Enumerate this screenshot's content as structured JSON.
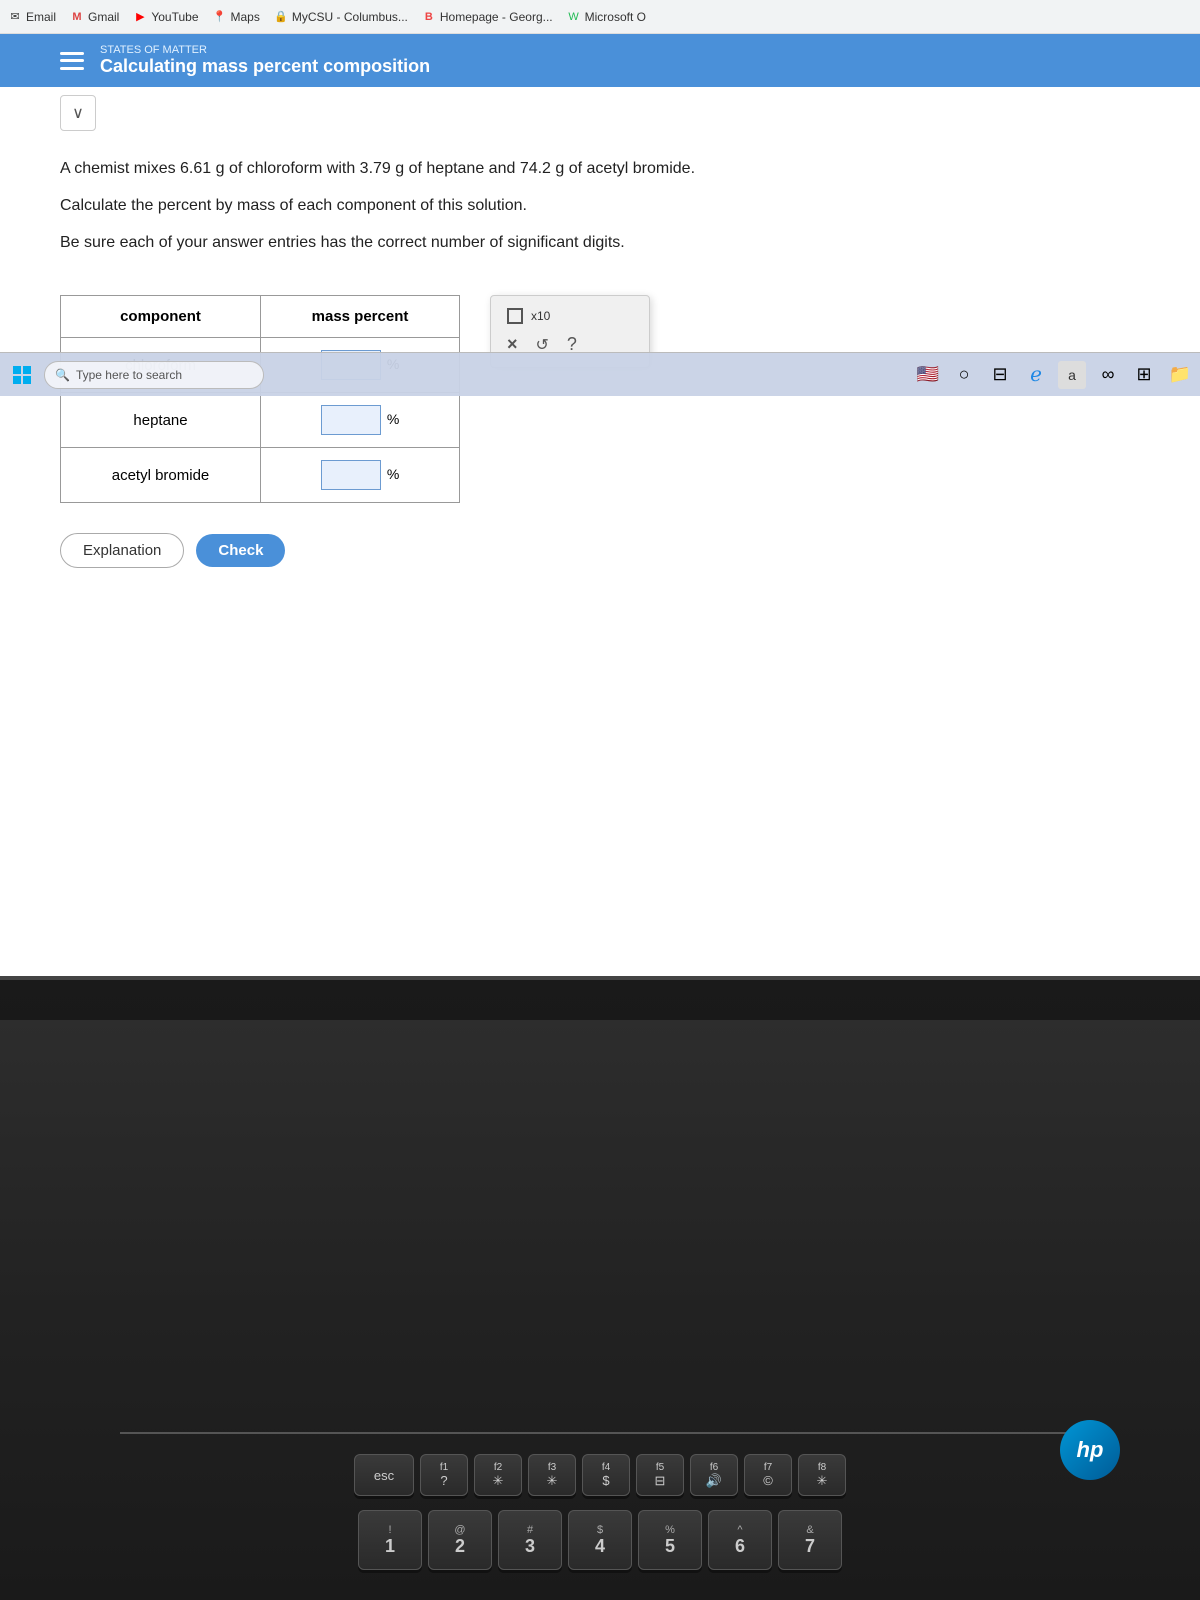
{
  "browser": {
    "tabs": [
      {
        "label": "States of Matter",
        "active": true
      }
    ],
    "bookmarks": [
      {
        "icon": "✉",
        "label": "Email"
      },
      {
        "icon": "M",
        "label": "Gmail"
      },
      {
        "icon": "▶",
        "label": "YouTube"
      },
      {
        "icon": "📍",
        "label": "Maps"
      },
      {
        "icon": "🔒",
        "label": "MyCSU - Columbus..."
      },
      {
        "icon": "B",
        "label": "Homepage - Georg..."
      },
      {
        "icon": "W",
        "label": "Microsoft O"
      }
    ]
  },
  "page": {
    "section_label": "STATES OF MATTER",
    "title": "Calculating mass percent composition",
    "dropdown_symbol": "∨",
    "question_lines": [
      "A chemist mixes 6.61 g of chloroform with 3.79 g of heptane and 74.2 g of acetyl bromide.",
      "Calculate the percent by mass of each component of this solution.",
      "Be sure each of your answer entries has the correct number of significant digits."
    ],
    "table": {
      "col1_header": "component",
      "col2_header": "mass percent",
      "rows": [
        {
          "component": "chloroform",
          "value": "",
          "unit": "%"
        },
        {
          "component": "heptane",
          "value": "",
          "unit": "%"
        },
        {
          "component": "acetyl bromide",
          "value": "",
          "unit": "%"
        }
      ]
    },
    "widget": {
      "checkbox_label": "x10",
      "x_label": "×",
      "undo_label": "↺",
      "help_label": "?"
    },
    "buttons": {
      "explanation": "Explanation",
      "check": "Check"
    }
  },
  "taskbar": {
    "search_placeholder": "Type here to search",
    "icons": [
      "🌐",
      "⊞",
      "○",
      "⊟",
      "a",
      "∞",
      "⊞",
      "📁"
    ]
  },
  "keyboard": {
    "fn_row": [
      "esc",
      "?",
      "*",
      "*",
      "$",
      "⊟",
      "olume",
      "©",
      "*"
    ],
    "num_row": [
      {
        "top": "!",
        "bot": "1"
      },
      {
        "top": "@",
        "bot": "2"
      },
      {
        "top": "#",
        "bot": "3"
      },
      {
        "top": "$",
        "bot": "4"
      },
      {
        "top": "%",
        "bot": "5"
      },
      {
        "top": "^",
        "bot": "6"
      },
      {
        "top": "&",
        "bot": "7"
      }
    ]
  },
  "hp_logo": "hp"
}
